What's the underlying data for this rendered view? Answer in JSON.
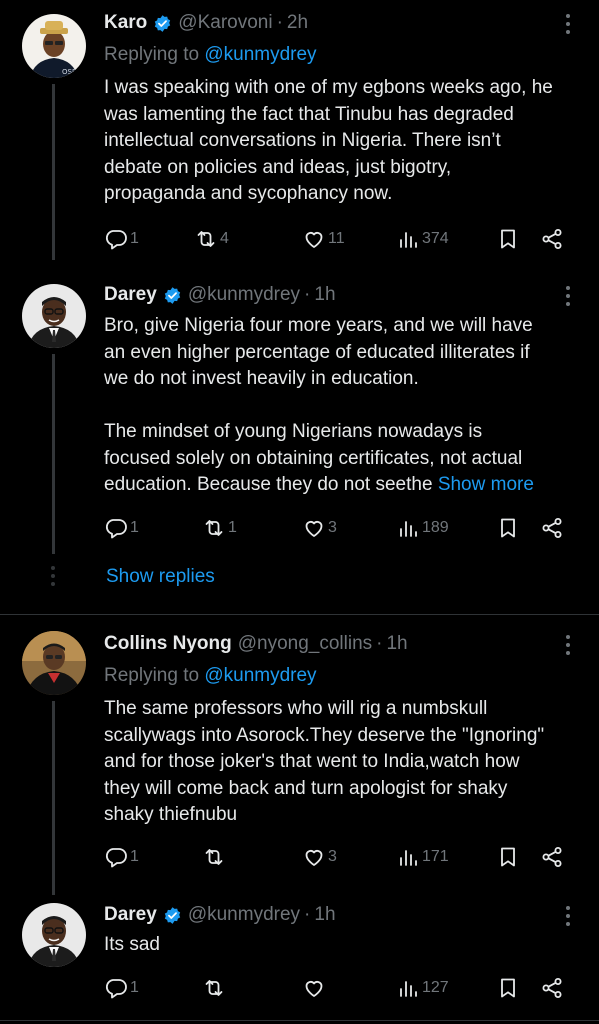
{
  "tweets": [
    {
      "name": "Karo",
      "handle": "@Karovoni",
      "time": "2h",
      "replying_label": "Replying to",
      "replying_handle": "@kunmydrey",
      "text_lines": [
        "I was speaking with one of my egbons weeks ago, he",
        "was lamenting the fact that Tinubu has degraded",
        "intellectual conversations in Nigeria. There isn’t",
        "debate on policies and ideas, just bigotry,",
        "propaganda and sycophancy now."
      ],
      "replies": "1",
      "reposts": "4",
      "likes": "11",
      "views": "374"
    },
    {
      "name": "Darey",
      "handle": "@kunmydrey",
      "time": "1h",
      "text_lines": [
        "Bro, give Nigeria four more years, and we will have",
        "an even higher percentage of educated illiterates if",
        "we do not invest heavily in education.",
        "",
        "The mindset of young Nigerians nowadays is",
        "focused solely on obtaining certificates, not actual",
        "education. Because they do not seethe"
      ],
      "show_more": "Show more",
      "replies": "1",
      "reposts": "1",
      "likes": "3",
      "views": "189"
    },
    {
      "name": "Collins Nyong",
      "handle": "@nyong_collins",
      "time": "1h",
      "replying_label": "Replying to",
      "replying_handle": "@kunmydrey",
      "text_lines": [
        "The same professors who will rig a numbskull",
        "scallywags into Asorock.They deserve the \"Ignoring\"",
        "and for those joker's that went to India,watch how",
        "they will come back and turn apologist for shaky",
        "shaky thiefnubu"
      ],
      "replies": "1",
      "reposts": "",
      "likes": "3",
      "views": "171"
    },
    {
      "name": "Darey",
      "handle": "@kunmydrey",
      "time": "1h",
      "text_lines": [
        "Its sad"
      ],
      "replies": "1",
      "reposts": "",
      "likes": "",
      "views": "127"
    }
  ],
  "show_replies": "Show replies",
  "dot_separator": "·",
  "colors": {
    "background": "#000000",
    "text": "#e7e9ea",
    "muted": "#71767b",
    "link": "#1d9bf0",
    "verified": "#1d9bf0",
    "line": "#333639"
  }
}
